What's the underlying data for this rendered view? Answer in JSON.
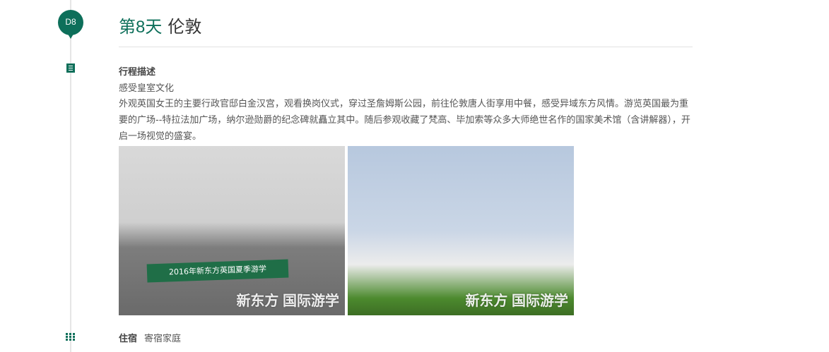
{
  "day": {
    "badge": "D8",
    "title": "第8天",
    "city": "伦敦"
  },
  "itinerary": {
    "label": "行程描述",
    "subtitle": "感受皇室文化",
    "description": "外观英国女王的主要行政官邸白金汉宫，观看换岗仪式，穿过圣詹姆斯公园，前往伦敦唐人街享用中餐，感受异域东方风情。游览英国最为重要的广场--特拉法加广场，纳尔逊勋爵的纪念碑就矗立其中。随后参观收藏了梵高、毕加索等众多大师绝世名作的国家美术馆（含讲解器），开启一场视觉的盛宴。"
  },
  "photos": [
    {
      "watermark": "新东方 国际游学",
      "banner": "2016年新东方英国夏季游学"
    },
    {
      "watermark": "新东方 国际游学"
    }
  ],
  "stay": {
    "label": "住宿",
    "value": "寄宿家庭"
  },
  "colors": {
    "accent": "#0d6f5a"
  }
}
